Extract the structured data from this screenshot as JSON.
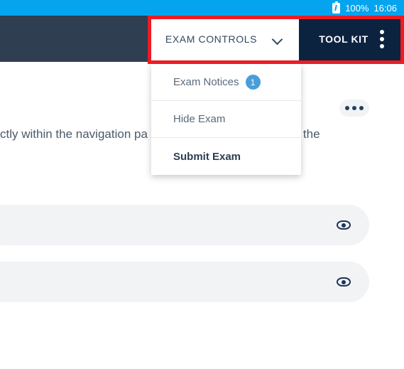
{
  "status_bar": {
    "battery_icon": "battery-icon",
    "battery_percent": "100%",
    "time": "16:06",
    "background_color": "#05a4ef"
  },
  "header": {
    "background_color": "#2f3e50",
    "exam_controls": {
      "label": "EXAM CONTROLS",
      "chevron_icon": "chevron-down-icon",
      "background_color": "#ffffff"
    },
    "tool_kit": {
      "label": "TOOL KIT",
      "kebab_icon": "kebab-menu-icon",
      "background_color": "#0c2340"
    }
  },
  "annotation": {
    "color": "#ec1c24",
    "shape": "rectangle-highlight"
  },
  "dropdown": {
    "items": [
      {
        "label": "Exam Notices",
        "badge": "1",
        "bold": false
      },
      {
        "label": "Hide Exam",
        "badge": null,
        "bold": false
      },
      {
        "label": "Submit Exam",
        "badge": null,
        "bold": true
      }
    ],
    "badge_color": "#4a9ed8"
  },
  "main": {
    "paragraph_left": "ctly within the navigation pa",
    "paragraph_right": "of the",
    "more_button": {
      "icon": "more-horizontal-icon"
    },
    "cards": [
      {
        "eye_icon": "eye-icon"
      },
      {
        "eye_icon": "eye-icon"
      }
    ],
    "card_color": "#f2f3f5"
  }
}
